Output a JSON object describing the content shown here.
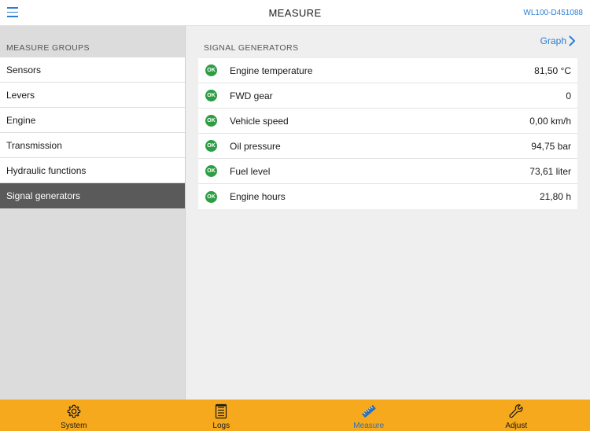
{
  "header": {
    "title": "MEASURE",
    "device_id": "WL100-D451088"
  },
  "sidebar": {
    "section_title": "MEASURE GROUPS",
    "items": [
      {
        "label": "Sensors"
      },
      {
        "label": "Levers"
      },
      {
        "label": "Engine"
      },
      {
        "label": "Transmission"
      },
      {
        "label": "Hydraulic functions"
      },
      {
        "label": "Signal generators",
        "active": true
      }
    ]
  },
  "main": {
    "section_title": "SIGNAL GENERATORS",
    "graph_label": "Graph",
    "status_label": "OK",
    "signals": [
      {
        "name": "Engine temperature",
        "value": "81,50 °C"
      },
      {
        "name": "FWD gear",
        "value": "0"
      },
      {
        "name": "Vehicle speed",
        "value": "0,00 km/h"
      },
      {
        "name": "Oil pressure",
        "value": "94,75 bar"
      },
      {
        "name": "Fuel level",
        "value": "73,61 liter"
      },
      {
        "name": "Engine hours",
        "value": "21,80 h"
      }
    ]
  },
  "tabs": [
    {
      "label": "System",
      "icon": "gear-icon"
    },
    {
      "label": "Logs",
      "icon": "log-icon"
    },
    {
      "label": "Measure",
      "icon": "ruler-icon",
      "active": true
    },
    {
      "label": "Adjust",
      "icon": "wrench-icon"
    }
  ],
  "colors": {
    "accent": "#2a7fd4",
    "tabbar": "#f7a91d",
    "ok": "#2e9e44",
    "active_item": "#5a5a5a"
  }
}
